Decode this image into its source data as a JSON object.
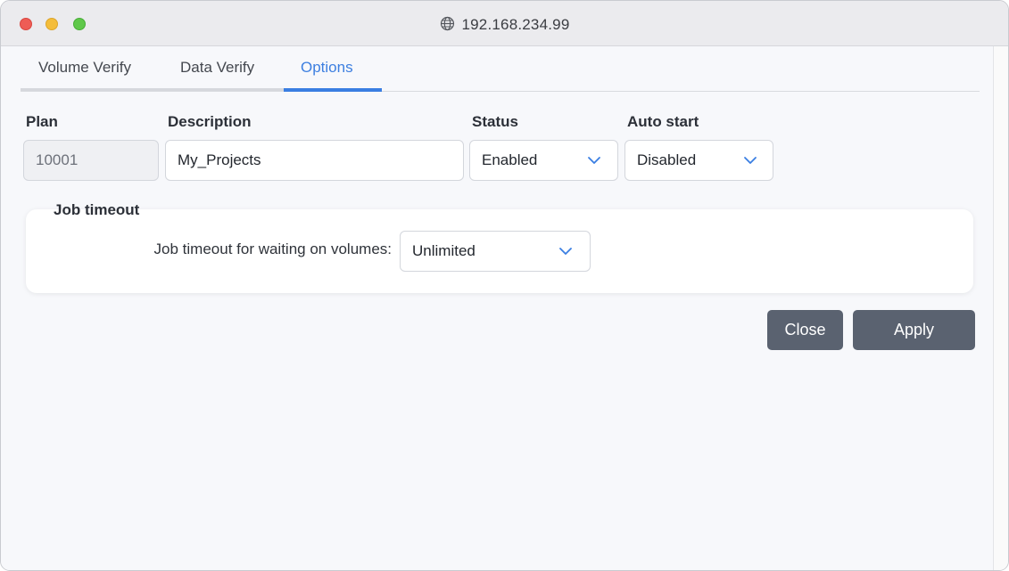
{
  "window": {
    "title": "192.168.234.99"
  },
  "tabs": [
    {
      "label": "Volume Verify"
    },
    {
      "label": "Data Verify"
    },
    {
      "label": "Options"
    }
  ],
  "form": {
    "plan": {
      "label": "Plan",
      "value": "10001"
    },
    "description": {
      "label": "Description",
      "value": "My_Projects"
    },
    "status": {
      "label": "Status",
      "value": "Enabled"
    },
    "auto_start": {
      "label": "Auto start",
      "value": "Disabled"
    }
  },
  "job_timeout": {
    "title": "Job timeout",
    "label": "Job timeout for waiting on volumes:",
    "value": "Unlimited"
  },
  "buttons": {
    "close": "Close",
    "apply": "Apply"
  },
  "colors": {
    "accent": "#3a7ee2",
    "button": "#5a6270"
  }
}
